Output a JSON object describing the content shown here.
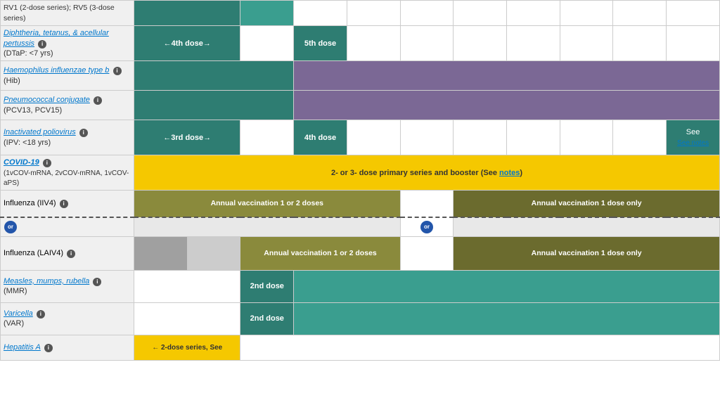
{
  "table": {
    "rows": [
      {
        "id": "rv",
        "name": "RV1 (2-dose series); RV5 (3-dose series)",
        "link": false,
        "sub": "",
        "cells": []
      },
      {
        "id": "dtap",
        "name": "Diphtheria, tetanus, & acellular pertussis",
        "link": true,
        "sub": "(DTaP: <7 yrs)",
        "dose_label": "←4th dose→",
        "dose5_label": "5th dose"
      },
      {
        "id": "hib",
        "name": "Haemophilus influenzae type b",
        "link": true,
        "sub": "(Hib)"
      },
      {
        "id": "pcv",
        "name": "Pneumococcal conjugate",
        "link": true,
        "sub": "(PCV13, PCV15)"
      },
      {
        "id": "ipv",
        "name": "Inactivated poliovirus",
        "link": true,
        "sub": "(IPV: <18 yrs)",
        "dose3_label": "←3rd dose→",
        "dose4_label": "4th dose",
        "see_notes": "See notes"
      },
      {
        "id": "covid",
        "name": "COVID-19",
        "link": true,
        "sub": "(1vCOV-mRNA, 2vCOV-mRNA, 1vCOV-aPS)",
        "label": "2- or 3- dose primary series and booster (See notes)"
      },
      {
        "id": "iiv4",
        "name": "Influenza (IIV4)",
        "link": false,
        "sub": "",
        "label1": "Annual vaccination 1 or 2 doses",
        "label2": "Annual vaccination 1 dose only"
      },
      {
        "id": "or-row",
        "label": "or"
      },
      {
        "id": "laiv4",
        "name": "Influenza (LAIV4)",
        "link": false,
        "sub": "",
        "label1": "Annual vaccination 1 or 2 doses",
        "label2": "Annual vaccination 1 dose only"
      },
      {
        "id": "mmr",
        "name": "Measles, mumps, rubella",
        "link": true,
        "sub": "(MMR)",
        "dose_label": "2nd dose"
      },
      {
        "id": "var",
        "name": "Varicella",
        "link": true,
        "sub": "(VAR)",
        "dose_label": "2nd dose"
      },
      {
        "id": "hepa",
        "name": "Hepatitis A",
        "link": true,
        "sub": "",
        "dose_label": "← 2-dose series, See"
      }
    ],
    "info_icon": "i",
    "or_label": "or"
  }
}
